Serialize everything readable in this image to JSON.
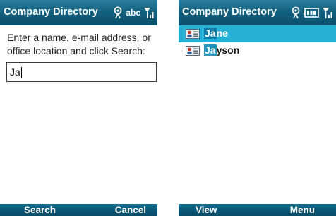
{
  "search_screen": {
    "title": "Company Directory",
    "input_mode": "abc",
    "prompt": "Enter a name, e-mail address, or office location and click Search:",
    "query": "Ja",
    "softkey_left": "Search",
    "softkey_right": "Cancel"
  },
  "results_screen": {
    "title": "Company Directory",
    "results": [
      {
        "match": "Ja",
        "rest": "ne",
        "selected": true
      },
      {
        "match": "Ja",
        "rest": "yson",
        "selected": false
      }
    ],
    "softkey_left": "View",
    "softkey_right": "Menu"
  },
  "colors": {
    "title_bar": "#13617f",
    "softkey_bar": "#0b5878",
    "selection": "#26b0d6",
    "match_highlight": "#1f95c0"
  },
  "icons": [
    "antenna-icon",
    "signal-strength-icon",
    "battery-icon",
    "contact-card-icon"
  ]
}
